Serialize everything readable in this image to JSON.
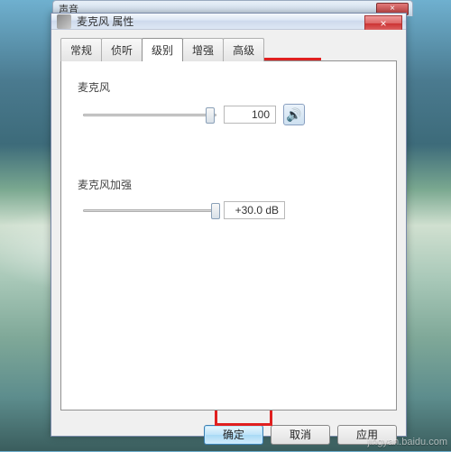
{
  "behind_window": {
    "title": "声音",
    "close": "×"
  },
  "window": {
    "title": "麦克风 属性",
    "close_glyph": "×"
  },
  "tabs": [
    {
      "label": "常规"
    },
    {
      "label": "侦听"
    },
    {
      "label": "级别"
    },
    {
      "label": "增强"
    },
    {
      "label": "高级"
    }
  ],
  "active_tab": "级别",
  "mic": {
    "label": "麦克风",
    "value": "100",
    "slider_pos_pct": 92,
    "speaker_glyph": "🔊"
  },
  "boost": {
    "label": "麦克风加强",
    "value": "+30.0 dB",
    "slider_pos_pct": 96
  },
  "buttons": {
    "ok": "确定",
    "cancel": "取消",
    "apply": "应用"
  },
  "watermark": "jingyan.baidu.com"
}
